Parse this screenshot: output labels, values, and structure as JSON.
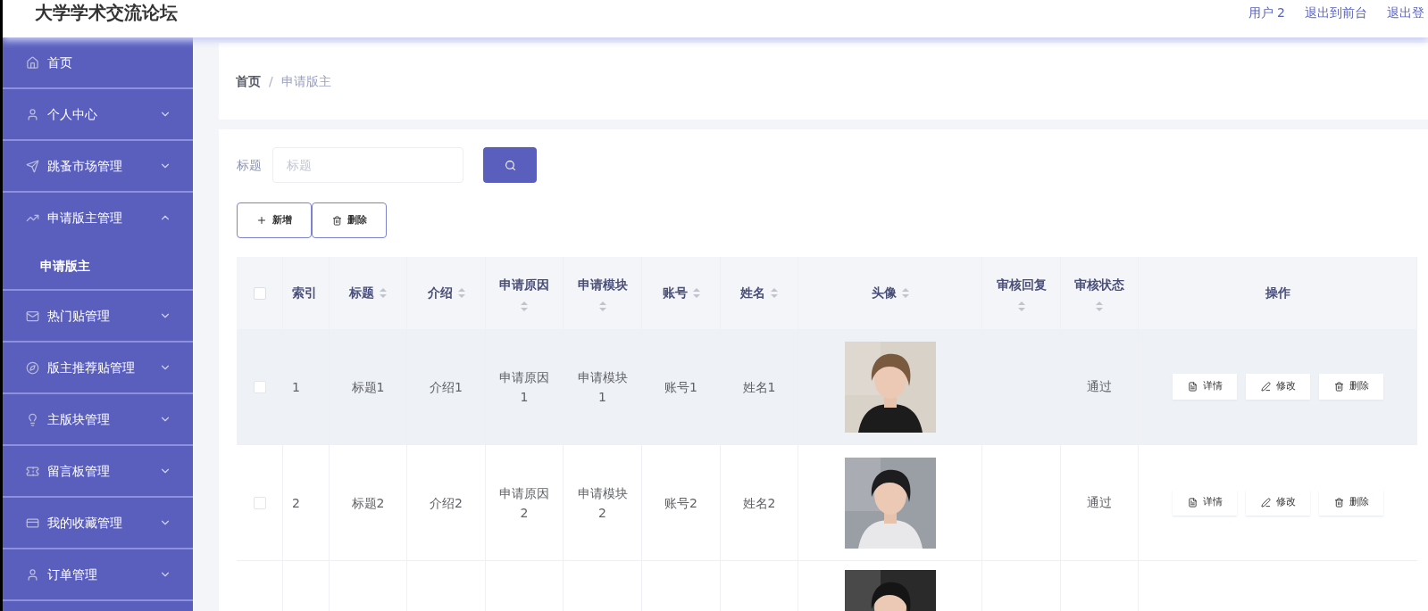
{
  "header": {
    "title": "大学学术交流论坛",
    "links": [
      "用户 2",
      "退出到前台",
      "退出登"
    ]
  },
  "sidebar": {
    "items": [
      {
        "label": "首页",
        "has_arrow": false
      },
      {
        "label": "个人中心",
        "has_arrow": true,
        "expanded": false
      },
      {
        "label": "跳蚤市场管理",
        "has_arrow": true,
        "expanded": false
      },
      {
        "label": "申请版主管理",
        "has_arrow": true,
        "expanded": true,
        "children": [
          {
            "label": "申请版主",
            "selected": true
          }
        ]
      },
      {
        "label": "热门贴管理",
        "has_arrow": true,
        "expanded": false
      },
      {
        "label": "版主推荐贴管理",
        "has_arrow": true,
        "expanded": false
      },
      {
        "label": "主版块管理",
        "has_arrow": true,
        "expanded": false
      },
      {
        "label": "留言板管理",
        "has_arrow": true,
        "expanded": false
      },
      {
        "label": "我的收藏管理",
        "has_arrow": true,
        "expanded": false
      },
      {
        "label": "订单管理",
        "has_arrow": true,
        "expanded": false
      }
    ]
  },
  "breadcrumb": [
    "首页",
    "申请版主"
  ],
  "breadcrumb_separator": "/",
  "search": {
    "label": "标题",
    "placeholder": "标题"
  },
  "toolbar": [
    {
      "kind": "add",
      "label": "新增"
    },
    {
      "kind": "delete",
      "label": "删除"
    }
  ],
  "table": {
    "select_all_checked": false,
    "columns": [
      {
        "label": "索引",
        "sortable": false
      },
      {
        "label": "标题",
        "sortable": true
      },
      {
        "label": "介绍",
        "sortable": true
      },
      {
        "label": "申请原因",
        "sortable": true
      },
      {
        "label": "申请模块",
        "sortable": true
      },
      {
        "label": "账号",
        "sortable": true
      },
      {
        "label": "姓名",
        "sortable": true
      },
      {
        "label": "头像",
        "sortable": true
      },
      {
        "label": "审核回复",
        "sortable": true
      },
      {
        "label": "审核状态",
        "sortable": true
      },
      {
        "label": "操作",
        "sortable": false
      }
    ],
    "rows": [
      {
        "checked": false,
        "hovered": true,
        "cells": [
          "1",
          "标题1",
          "介绍1",
          "申请原因\n1",
          "申请模块\n1",
          "账号1",
          "姓名1"
        ],
        "status": "通过",
        "actions": [
          {
            "kind": "detail",
            "label": "详情"
          },
          {
            "kind": "edit",
            "label": "修改"
          },
          {
            "kind": "delete",
            "label": "删除"
          }
        ]
      },
      {
        "checked": false,
        "hovered": false,
        "cells": [
          "2",
          "标题2",
          "介绍2",
          "申请原因\n2",
          "申请模块\n2",
          "账号2",
          "姓名2"
        ],
        "status": "通过",
        "actions": [
          {
            "kind": "detail",
            "label": "详情"
          },
          {
            "kind": "edit",
            "label": "修改"
          },
          {
            "kind": "delete",
            "label": "删除"
          }
        ]
      },
      {
        "partial": true
      }
    ]
  }
}
